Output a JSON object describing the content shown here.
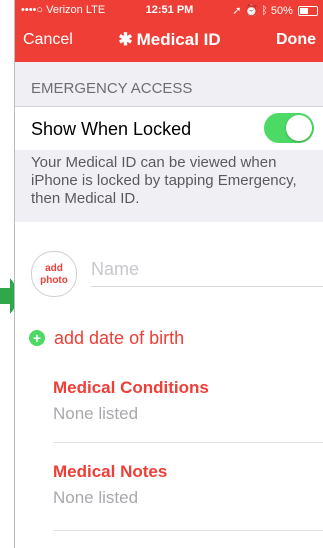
{
  "status_bar": {
    "carrier": "••••○ Verizon  LTE",
    "time": "12:51 PM",
    "battery": "50%",
    "battery_level": 0.5
  },
  "nav": {
    "cancel": "Cancel",
    "title": "Medical ID",
    "title_icon": "asterisk-icon",
    "done": "Done"
  },
  "emergency": {
    "header": "EMERGENCY ACCESS",
    "show_when_locked_label": "Show When Locked",
    "toggle_on": true,
    "description": "Your Medical ID can be viewed when iPhone is locked by tapping Emergency, then Medical ID."
  },
  "profile": {
    "add_photo_line1": "add",
    "add_photo_line2": "photo",
    "name_placeholder": "Name",
    "add_dob": "add date of birth"
  },
  "fields": [
    {
      "title": "Medical Conditions",
      "value": "None listed"
    },
    {
      "title": "Medical Notes",
      "value": "None listed"
    }
  ],
  "colors": {
    "accent": "#ef3e36",
    "toggle_on": "#4cd964",
    "arrow": "#2ea84a"
  }
}
